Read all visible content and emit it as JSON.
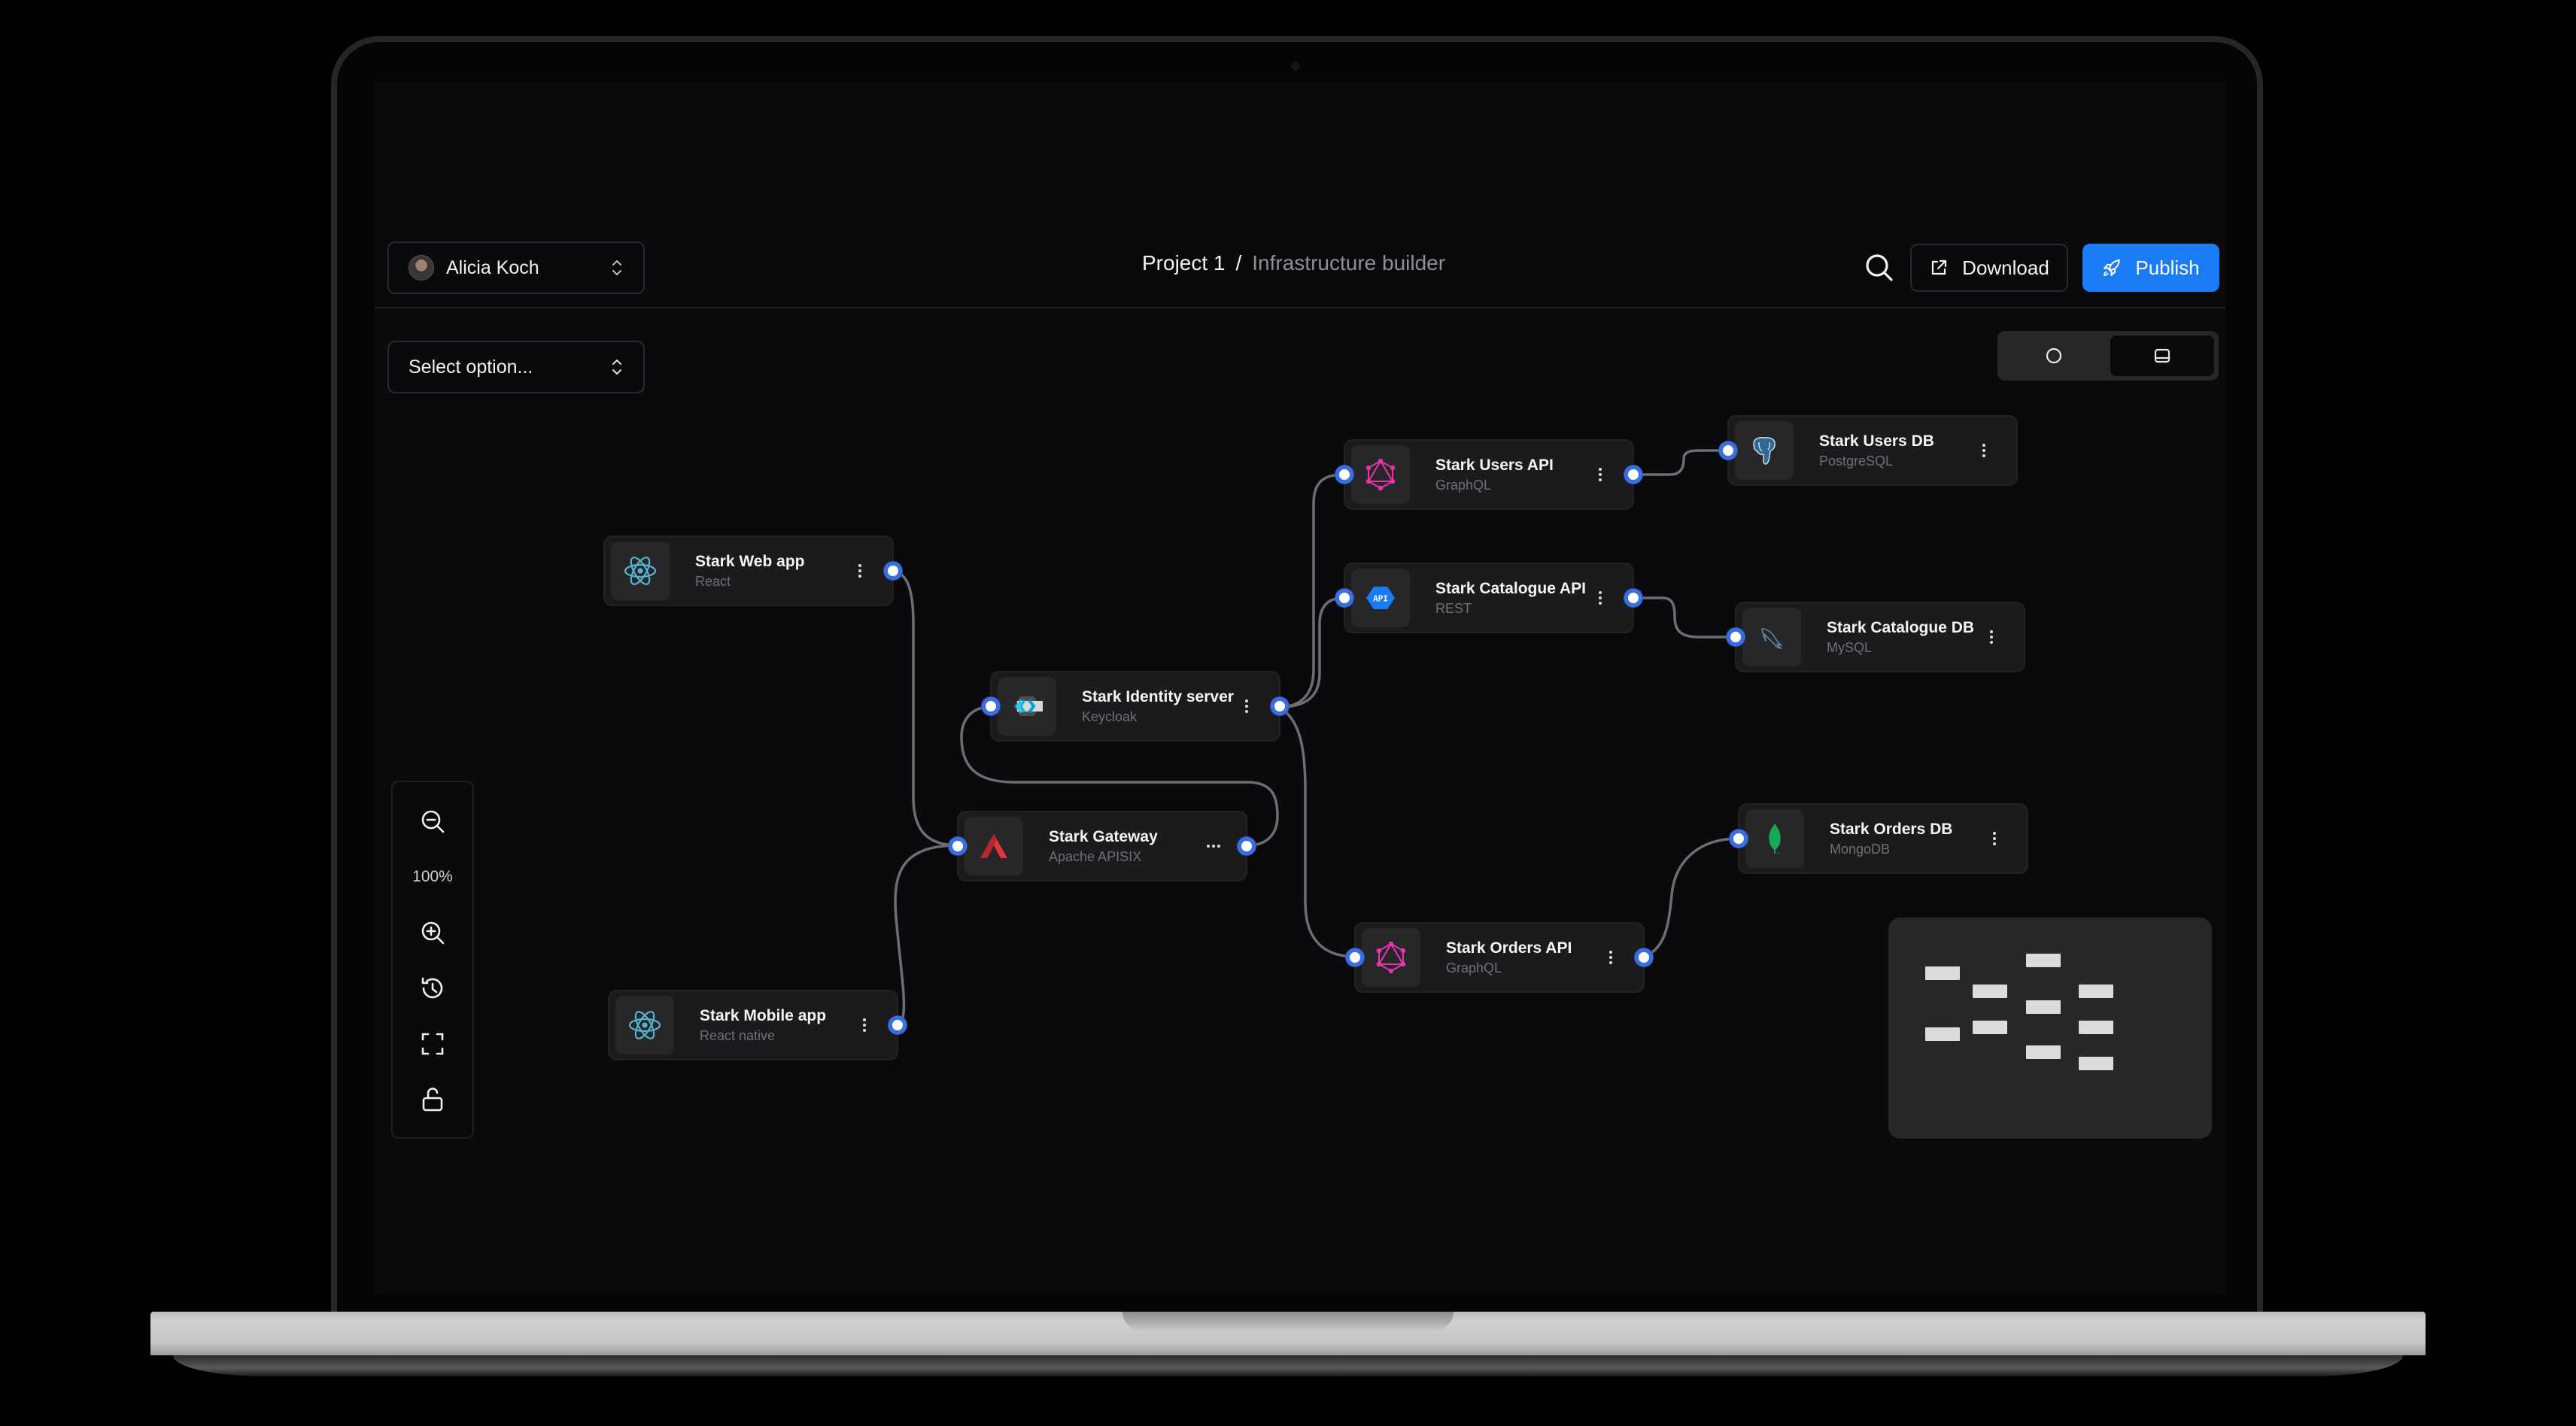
{
  "header": {
    "account": {
      "name": "Alicia Koch"
    },
    "breadcrumb": {
      "project": "Project 1",
      "separator": "/",
      "page": "Infrastructure builder"
    },
    "actions": {
      "download_label": "Download",
      "publish_label": "Publish"
    }
  },
  "toolbar": {
    "select": {
      "placeholder": "Select option..."
    },
    "view_toggle": {
      "options": [
        "circle-view",
        "panel-view"
      ],
      "active": "panel-view"
    }
  },
  "colors": {
    "accent": "#1a7cf5",
    "handle": "#3b6fe0",
    "canvas": "#0a0a0c",
    "node": "#1b1b1e",
    "edge": "#6e6e72"
  },
  "nodes": [
    {
      "id": "web",
      "title": "Stark Web app",
      "subtitle": "React",
      "icon": "react-icon",
      "menu": "vertical-dots"
    },
    {
      "id": "mobile",
      "title": "Stark Mobile app",
      "subtitle": "React native",
      "icon": "react-icon",
      "menu": "vertical-dots"
    },
    {
      "id": "gateway",
      "title": "Stark Gateway",
      "subtitle": "Apache APISIX",
      "icon": "apisix-icon",
      "menu": "horizontal-dots"
    },
    {
      "id": "identity",
      "title": "Stark Identity server",
      "subtitle": "Keycloak",
      "icon": "keycloak-icon",
      "menu": "vertical-dots"
    },
    {
      "id": "users_api",
      "title": "Stark Users API",
      "subtitle": "GraphQL",
      "icon": "graphql-icon",
      "menu": "vertical-dots"
    },
    {
      "id": "catalogue_api",
      "title": "Stark Catalogue API",
      "subtitle": "REST",
      "icon": "rest-api-icon",
      "menu": "vertical-dots"
    },
    {
      "id": "orders_api",
      "title": "Stark Orders API",
      "subtitle": "GraphQL",
      "icon": "graphql-icon",
      "menu": "vertical-dots"
    },
    {
      "id": "users_db",
      "title": "Stark Users DB",
      "subtitle": "PostgreSQL",
      "icon": "postgresql-icon",
      "menu": "vertical-dots"
    },
    {
      "id": "catalogue_db",
      "title": "Stark Catalogue DB",
      "subtitle": "MySQL",
      "icon": "mysql-icon",
      "menu": "vertical-dots"
    },
    {
      "id": "orders_db",
      "title": "Stark Orders DB",
      "subtitle": "MongoDB",
      "icon": "mongodb-icon",
      "menu": "vertical-dots"
    }
  ],
  "edges": [
    {
      "from": "web",
      "to": "gateway"
    },
    {
      "from": "mobile",
      "to": "gateway"
    },
    {
      "from": "gateway",
      "to": "identity"
    },
    {
      "from": "identity",
      "to": "users_api"
    },
    {
      "from": "identity",
      "to": "catalogue_api"
    },
    {
      "from": "identity",
      "to": "orders_api"
    },
    {
      "from": "users_api",
      "to": "users_db"
    },
    {
      "from": "catalogue_api",
      "to": "catalogue_db"
    },
    {
      "from": "orders_api",
      "to": "orders_db"
    }
  ],
  "zoom_controls": {
    "level": "100%",
    "buttons": [
      "zoom-out",
      "zoom-in",
      "history",
      "fit-view",
      "lock"
    ]
  },
  "minimap": {
    "node_count": 10
  }
}
